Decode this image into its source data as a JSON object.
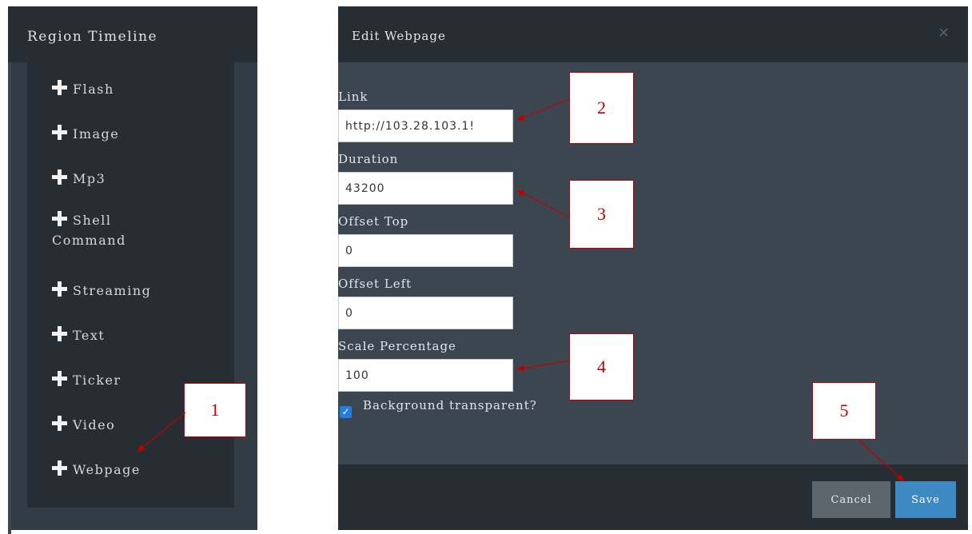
{
  "left_panel": {
    "title": "Region Timeline",
    "items": [
      {
        "label": "Flash",
        "icon": "plus-icon"
      },
      {
        "label": "Image",
        "icon": "plus-icon"
      },
      {
        "label": "Mp3",
        "icon": "plus-icon"
      },
      {
        "label": "Shell",
        "label2": "Command",
        "icon": "plus-icon"
      },
      {
        "label": "Streaming",
        "icon": "plus-icon"
      },
      {
        "label": "Text",
        "icon": "plus-icon"
      },
      {
        "label": "Ticker",
        "icon": "plus-icon"
      },
      {
        "label": "Video",
        "icon": "plus-icon"
      },
      {
        "label": "Webpage",
        "icon": "plus-icon"
      }
    ]
  },
  "modal": {
    "title": "Edit Webpage",
    "close_icon": "×",
    "fields": {
      "link": {
        "label": "Link",
        "value": "http://103.28.103.1!"
      },
      "duration": {
        "label": "Duration",
        "value": "43200"
      },
      "offset_top": {
        "label": "Offset Top",
        "value": "0"
      },
      "offset_left": {
        "label": "Offset Left",
        "value": "0"
      },
      "scale": {
        "label": "Scale Percentage",
        "value": "100"
      }
    },
    "background_transparent": {
      "label": "Background transparent?",
      "checked": true,
      "check_glyph": "✓"
    },
    "cancel_label": "Cancel",
    "save_label": "Save"
  },
  "annotations": [
    "1",
    "2",
    "3",
    "4",
    "5"
  ],
  "colors": {
    "panel_bg": "#323c45",
    "header_bg": "#262d33",
    "save_button": "#3d8ac2",
    "cancel_button": "#5d666d",
    "callout_red": "#c00000",
    "checkbox_blue": "#1f7ee0"
  }
}
